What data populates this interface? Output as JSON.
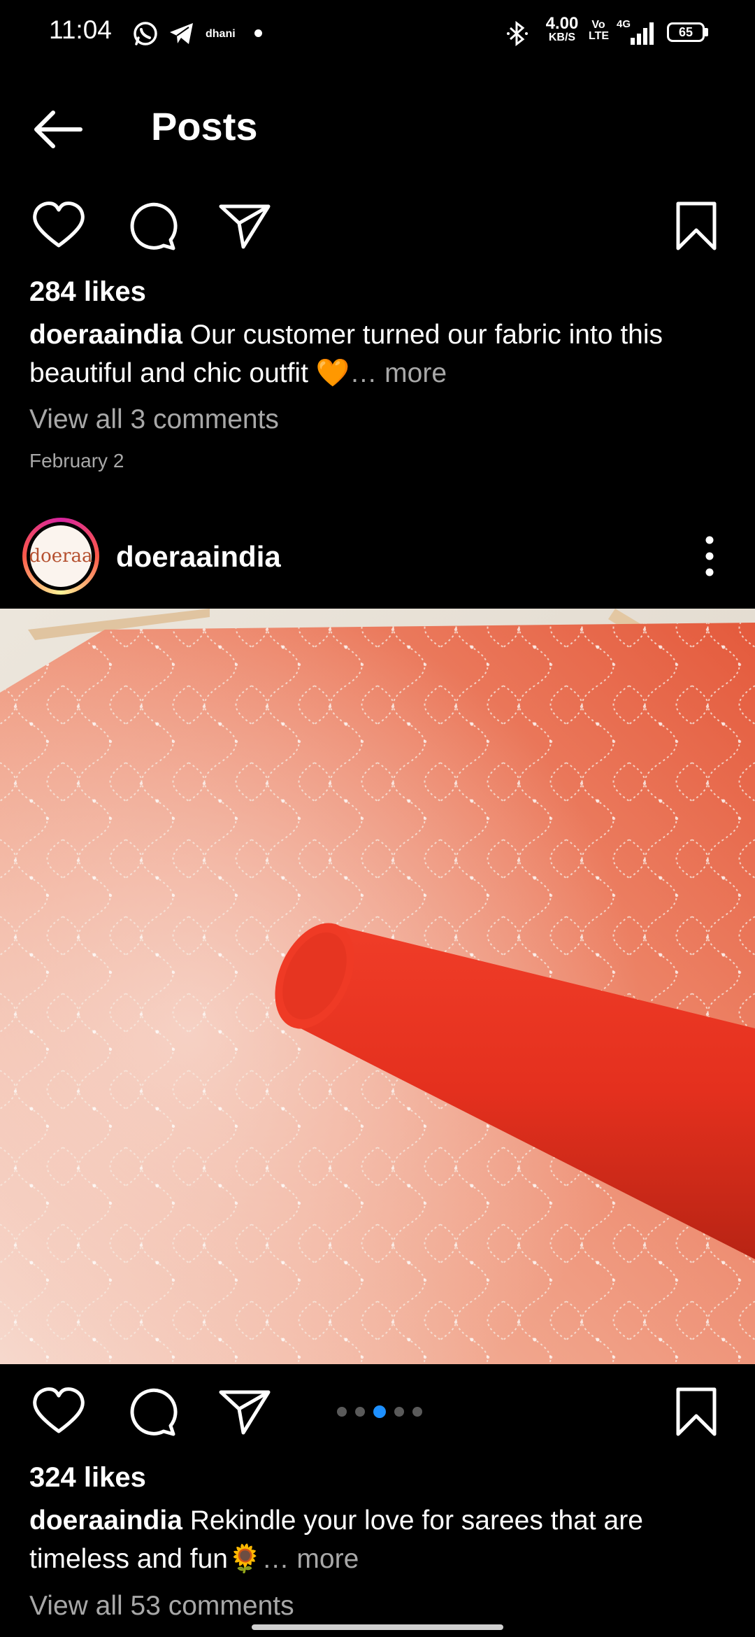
{
  "status_bar": {
    "time": "11:04",
    "carrier_label": "dhani",
    "net_speed_value": "4.00",
    "net_speed_unit": "KB/S",
    "volte_label_top": "Vo",
    "volte_label_bottom": "LTE",
    "network_type": "4G",
    "battery": "65"
  },
  "header": {
    "title": "Posts"
  },
  "post1": {
    "likes": "284 likes",
    "username": "doeraaindia",
    "caption_text": " Our customer turned our fabric into this beautiful and chic outfit 🧡",
    "more": "… more",
    "comments_link": "View all 3 comments",
    "date": "February 2"
  },
  "post2": {
    "username": "doeraaindia",
    "avatar_logo_text": "doeraa",
    "likes": "324 likes",
    "caption_text": " Rekindle your love for sarees that are timeless and fun🌻",
    "more": "… more",
    "comments_link": "View all 53 comments",
    "carousel": {
      "count": 5,
      "active_index": 2
    }
  },
  "colors": {
    "background": "#000000",
    "secondary_text": "#a8a8a8",
    "carousel_active": "#1e90ff"
  },
  "icons": [
    "back-arrow-icon",
    "heart-icon",
    "comment-icon",
    "share-icon",
    "bookmark-icon",
    "more-vertical-icon"
  ]
}
